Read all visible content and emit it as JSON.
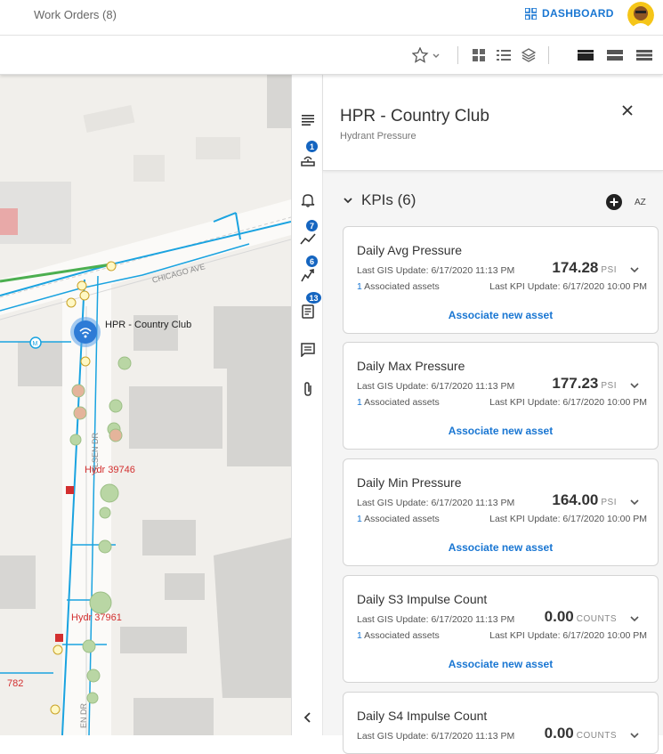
{
  "topbar": {
    "work_orders": "Work Orders (8)",
    "dashboard": "DASHBOARD"
  },
  "map": {
    "feature_label": "HPR - Country Club",
    "street_chicago": "CHICAGO AVE",
    "street_olsen": "OLSEN DR",
    "street_olsen_lower": "EN DR",
    "hydrant_1": "Hydr 39746",
    "hydrant_2": "Hydr 37961",
    "hydrant_3": "782"
  },
  "rail": {
    "badge_assets": "1",
    "badge_kpi": "7",
    "badge_work": "6",
    "badge_notes": "13"
  },
  "panel": {
    "title": "HPR - Country Club",
    "subtitle": "Hydrant Pressure",
    "kpi_header": "KPIs (6)",
    "sort_label": "AZ"
  },
  "kpis": [
    {
      "name": "Daily Avg Pressure",
      "gis_update": "Last GIS Update: 6/17/2020 11:13 PM",
      "value": "174.28",
      "unit": "PSI",
      "assoc_count": "1",
      "assoc_label": " Associated assets",
      "kpi_update": "Last KPI Update: 6/17/2020 10:00 PM",
      "link": "Associate new asset"
    },
    {
      "name": "Daily Max Pressure",
      "gis_update": "Last GIS Update: 6/17/2020 11:13 PM",
      "value": "177.23",
      "unit": "PSI",
      "assoc_count": "1",
      "assoc_label": " Associated assets",
      "kpi_update": "Last KPI Update: 6/17/2020 10:00 PM",
      "link": "Associate new asset"
    },
    {
      "name": "Daily Min Pressure",
      "gis_update": "Last GIS Update: 6/17/2020 11:13 PM",
      "value": "164.00",
      "unit": "PSI",
      "assoc_count": "1",
      "assoc_label": " Associated assets",
      "kpi_update": "Last KPI Update: 6/17/2020 10:00 PM",
      "link": "Associate new asset"
    },
    {
      "name": "Daily S3 Impulse Count",
      "gis_update": "Last GIS Update: 6/17/2020 11:13 PM",
      "value": "0.00",
      "unit": "COUNTS",
      "assoc_count": "1",
      "assoc_label": " Associated assets",
      "kpi_update": "Last KPI Update: 6/17/2020 10:00 PM",
      "link": "Associate new asset"
    },
    {
      "name": "Daily S4 Impulse Count",
      "gis_update": "Last GIS Update: 6/17/2020 11:13 PM",
      "value": "0.00",
      "unit": "COUNTS"
    }
  ],
  "colors": {
    "accent": "#1976d2",
    "pipe": "#1aa3e0",
    "badge": "#1565c0",
    "hydrant_label": "#d32f2f"
  },
  "icons": [
    "dashboard-icon",
    "star-settings-icon",
    "grid-view-icon",
    "list-view-icon",
    "layers-icon",
    "layout-icon",
    "close-icon",
    "chevron-down-icon",
    "add-circle-icon",
    "sort-az-icon",
    "list-icon",
    "assets-icon",
    "bell-icon",
    "trend-icon",
    "work-icon",
    "notes-icon",
    "comment-icon",
    "attachment-icon",
    "collapse-chevron-icon"
  ]
}
